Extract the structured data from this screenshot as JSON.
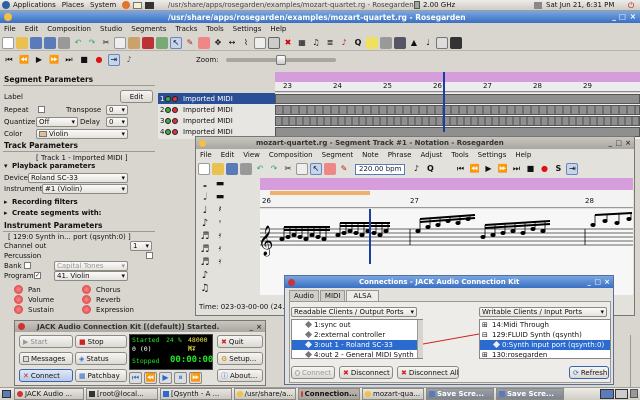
{
  "top_panel": {
    "menus": [
      "Applications",
      "Places",
      "System"
    ],
    "window_title": "/usr/share/apps/rosegarden/examples/mozart-quartet.rg - Rosegarden",
    "cpu_freq": "2.00 GHz",
    "clock": "Sat Jun 21,  6:31 PM"
  },
  "main_menu": [
    "File",
    "Edit",
    "Composition",
    "Studio",
    "Segments",
    "Tracks",
    "Tools",
    "Settings",
    "Help"
  ],
  "zoom": {
    "label": "Zoom:"
  },
  "ruler_ticks": [
    "23",
    "24",
    "25",
    "26",
    "27",
    "28",
    "29"
  ],
  "segment_params": {
    "title": "Segment Parameters",
    "label_label": "Label",
    "edit_button": "Edit",
    "repeat_label": "Repeat",
    "transpose_label": "Transpose",
    "transpose_value": "0",
    "quantize_label": "Quantize",
    "quantize_value": "Off",
    "delay_label": "Delay",
    "delay_value": "0",
    "color_label": "Color",
    "color_value": "Violin"
  },
  "track_params": {
    "title": "Track Parameters",
    "track_name": "[ Track 1 - Imported MIDI ]",
    "playback_title": "Playback parameters",
    "device_label": "Device",
    "device_value": "Roland SC-33",
    "instrument_label": "Instrument",
    "instrument_value": "#1 (Violin)",
    "recording_filters": "Recording filters",
    "create_segments": "Create segments with:"
  },
  "instrument_params": {
    "title": "Instrument Parameters",
    "synth_port": "[ 129:0 Synth in... port (qsynth:0) ]",
    "channel_out_label": "Channel out",
    "channel_out_value": "1",
    "percussion_label": "Percussion",
    "bank_label": "Bank",
    "bank_value": "Capital Tones",
    "program_label": "Program",
    "program_value": "41. Violin",
    "knobs": [
      "Pan",
      "Chorus",
      "Volume",
      "Reverb",
      "Sustain",
      "Expression"
    ]
  },
  "tracks": [
    {
      "number": "1",
      "name": "Imported MIDI",
      "selected": true
    },
    {
      "number": "2",
      "name": "Imported MIDI",
      "selected": false
    },
    {
      "number": "3",
      "name": "Imported MIDI",
      "selected": false
    },
    {
      "number": "4",
      "name": "Imported MIDI",
      "selected": false
    }
  ],
  "notation_window": {
    "title": "mozart-quartet.rg - Segment Track #1 - Notation - Rosegarden",
    "menus": [
      "File",
      "Edit",
      "View",
      "Composition",
      "Segment",
      "Note",
      "Phrase",
      "Adjust",
      "Tools",
      "Settings",
      "Help"
    ],
    "tempo": "220.00 bpm",
    "ruler_ticks": [
      "26",
      "27",
      "28"
    ],
    "status_time": "Time: 023-03-00-00 (24.54"
  },
  "jack_connections": {
    "title": "Connections - JACK Audio Connection Kit",
    "tabs": [
      "Audio",
      "MIDI",
      "ALSA"
    ],
    "active_tab": "ALSA",
    "readable_label": "Readable Clients / Output Ports",
    "writable_label": "Writable Clients / Input Ports",
    "readable_items": [
      {
        "text": "1:sync out",
        "selected": false
      },
      {
        "text": "2:external controller",
        "selected": false
      },
      {
        "text": "3:out 1 - Roland SC-33",
        "selected": true
      },
      {
        "text": "4:out 2 - General MIDI Synth",
        "selected": false
      }
    ],
    "writable_items": [
      {
        "text": "14:Midi Through",
        "selected": false,
        "indent": 0
      },
      {
        "text": "129:FLUID Synth (qsynth)",
        "selected": false,
        "indent": 0
      },
      {
        "text": "0:Synth input port (qsynth:0)",
        "selected": true,
        "indent": 1
      },
      {
        "text": "130:rosegarden",
        "selected": false,
        "indent": 0
      }
    ],
    "connect_button": "Connect",
    "disconnect_button": "Disconnect",
    "disconnect_all_button": "Disconnect All",
    "refresh_button": "Refresh"
  },
  "qjackctl": {
    "title": "JACK Audio Connection Kit [(default)] Started.",
    "start_button": "Start",
    "stop_button": "Stop",
    "quit_button": "Quit",
    "messages_button": "Messages",
    "status_button": "Status",
    "setup_button": "Setup...",
    "connect_button": "Connect",
    "patchbay_button": "Patchbay",
    "about_button": "About...",
    "display_started": "Started",
    "display_percent": "24 %",
    "display_rate": "48000 Hz",
    "display_zero": "0 (0)",
    "display_rt": "RT",
    "display_stopped": "Stopped",
    "display_time": "00:00:00"
  },
  "taskbar": [
    "JACK Audio ...",
    "[root@local...",
    "[Qsynth - A ...",
    "/usr/share/a...",
    "Connection...",
    "mozart-qua...",
    "Save Scre...",
    "Save Scre..."
  ]
}
